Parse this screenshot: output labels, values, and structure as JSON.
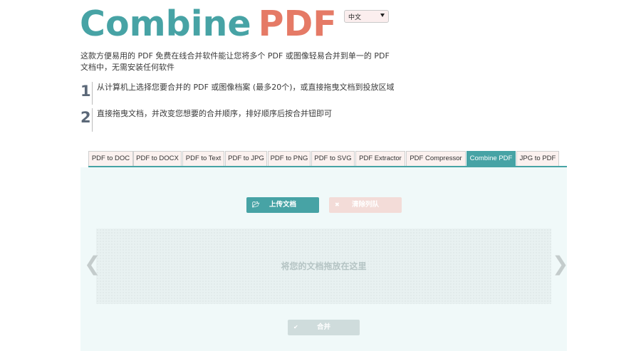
{
  "logo": {
    "word1": "Combine",
    "word2": "PDF"
  },
  "language_select": {
    "value": "中文"
  },
  "intro": "这款方便易用的 PDF 免费在线合并软件能让您将多个 PDF 或图像轻易合并到单一的 PDF 文档中，无需安装任何软件",
  "steps": [
    {
      "number": "1",
      "text": "从计算机上选择您要合并的 PDF 或图像档案 (最多20个)，或直接拖曳文档到投放区域"
    },
    {
      "number": "2",
      "text": "直接拖曳文档，并改变您想要的合并顺序，排好顺序后按合并钮即可"
    }
  ],
  "tabs": [
    {
      "label": "PDF to DOC"
    },
    {
      "label": "PDF to DOCX"
    },
    {
      "label": "PDF to Text"
    },
    {
      "label": "PDF to JPG"
    },
    {
      "label": "PDF to PNG"
    },
    {
      "label": "PDF to SVG"
    },
    {
      "label": "PDF Extractor"
    },
    {
      "label": "PDF Compressor"
    },
    {
      "label": "Combine PDF"
    },
    {
      "label": "JPG to PDF"
    }
  ],
  "active_tab": "Combine PDF",
  "upload_button": {
    "label": "上传文档",
    "icon": "folder-open-icon"
  },
  "clear_button": {
    "label": "清除列队",
    "icon": "close-icon"
  },
  "dropzone": {
    "message": "将您的文档拖放在这里"
  },
  "nav": {
    "prev": "❮",
    "next": "❯"
  },
  "combine_button": {
    "label": "合并",
    "icon": "checkmark-icon"
  },
  "colors": {
    "accent": "#47a3a5",
    "logo_secondary": "#e57a66",
    "panel_background": "#f0f9f9",
    "tab_background": "#fbf1ef"
  }
}
